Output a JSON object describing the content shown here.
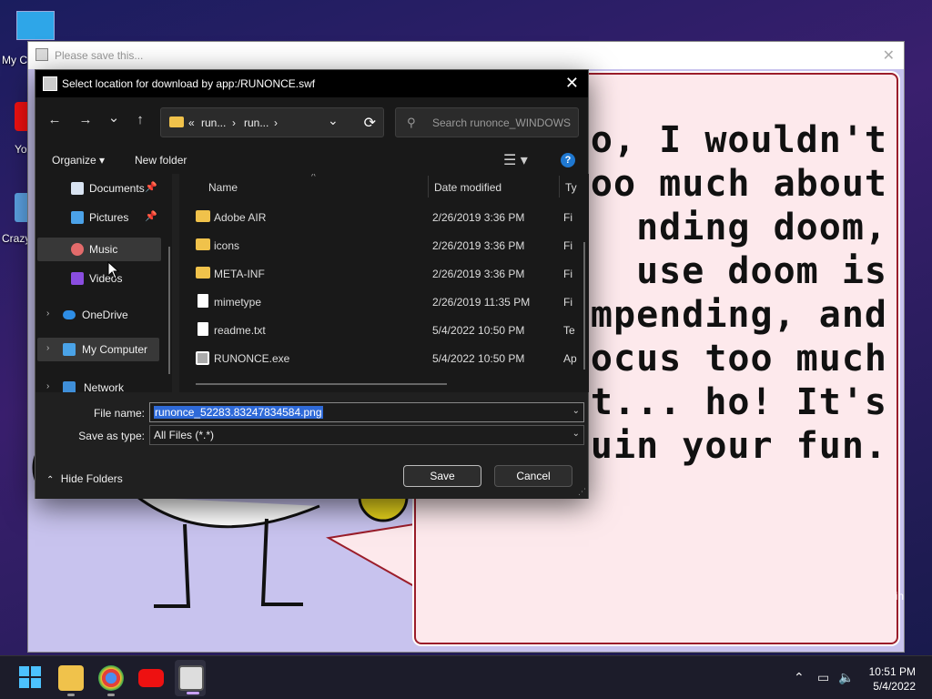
{
  "desktop": {
    "icons": [
      {
        "label": "My C",
        "name": "my-computer"
      },
      {
        "label": "Yo",
        "name": "youtube"
      },
      {
        "label": "Crazy",
        "name": "crazy"
      }
    ]
  },
  "app_window": {
    "title": "Please save this...",
    "speech_lines": "o, I wouldn't\noo much about\nnding doom,\nuse doom is\nimpending, and\nfocus too much\nat... ho! It's\n ruin your fun.",
    "corner_text": "in"
  },
  "dialog": {
    "title": "Select location for download by app:/RUNONCE.swf",
    "nav": {
      "back": "←",
      "forward": "→",
      "recent": "⌄",
      "up": "↑"
    },
    "address": {
      "prefix": "«",
      "crumb1": "run...",
      "sep": "›",
      "crumb2": "run...",
      "sep2": "›",
      "dropdown": "⌄",
      "refresh": "⟳"
    },
    "search": {
      "placeholder": "Search runonce_WINDOWS",
      "icon": "⚲"
    },
    "toolbar": {
      "organize": "Organize ▾",
      "new_folder": "New folder",
      "view": "☰ ▾",
      "help": "?"
    },
    "navpane": [
      {
        "label": "Documents",
        "pinned": true,
        "color": "#d9e4f2"
      },
      {
        "label": "Pictures",
        "pinned": true,
        "color": "#4ba2e8"
      },
      {
        "label": "Music",
        "pinned": false,
        "color": "#e36b6b",
        "active": true
      },
      {
        "label": "Videos",
        "pinned": false,
        "color": "#8a4de0"
      },
      {
        "label": "OneDrive",
        "pinned": false,
        "color": "#2e8ee6",
        "expand": true
      },
      {
        "label": "My Computer",
        "pinned": false,
        "color": "#4aa3e8",
        "expand": true
      },
      {
        "label": "Network",
        "pinned": false,
        "color": "#3f8fd9",
        "expand": true
      }
    ],
    "pin_glyph": "📌",
    "expand_glyph": "›",
    "columns": {
      "name": "Name",
      "date": "Date modified",
      "type": "Ty"
    },
    "files": [
      {
        "name": "Adobe AIR",
        "date": "2/26/2019 3:36 PM",
        "type": "Fi",
        "kind": "folder"
      },
      {
        "name": "icons",
        "date": "2/26/2019 3:36 PM",
        "type": "Fi",
        "kind": "folder"
      },
      {
        "name": "META-INF",
        "date": "2/26/2019 3:36 PM",
        "type": "Fi",
        "kind": "folder"
      },
      {
        "name": "mimetype",
        "date": "2/26/2019 11:35 PM",
        "type": "Fi",
        "kind": "file"
      },
      {
        "name": "readme.txt",
        "date": "5/4/2022 10:50 PM",
        "type": "Te",
        "kind": "file"
      },
      {
        "name": "RUNONCE.exe",
        "date": "5/4/2022 10:50 PM",
        "type": "Ap",
        "kind": "exe"
      }
    ],
    "file_name_label": "File name:",
    "file_name_value": "runonce_52283.83247834584.png",
    "save_type_label": "Save as type:",
    "save_type_value": "All Files (*.*)",
    "hide_folders": "Hide Folders",
    "save": "Save",
    "cancel": "Cancel"
  },
  "taskbar": {
    "time": "10:51 PM",
    "date": "5/4/2022",
    "tray": {
      "chevron": "⌃",
      "network": "▭",
      "volume": "🔈"
    }
  },
  "colors": {
    "folder": "#f0c24b",
    "selection": "#2f6ad8",
    "accent": "#1f78d1",
    "bubble_border": "#9b1d2a"
  }
}
